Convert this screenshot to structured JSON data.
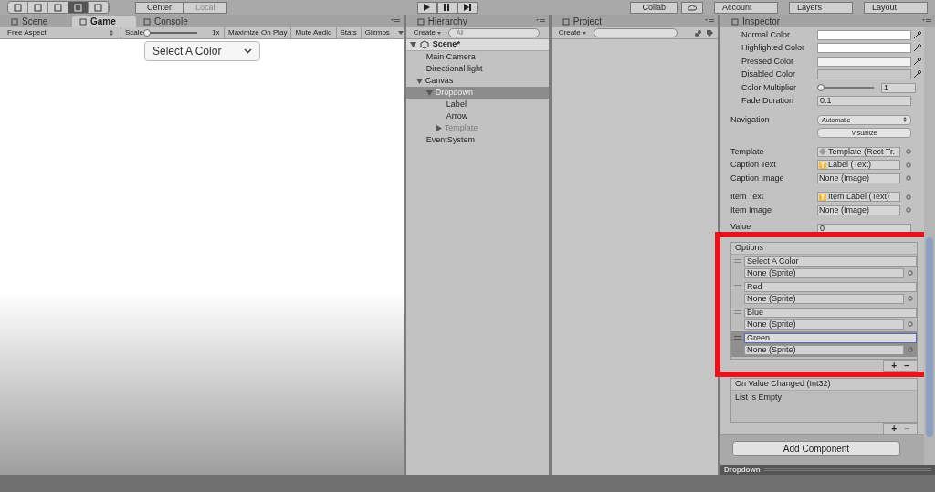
{
  "toolbar": {
    "pivot": [
      "Center",
      "Local"
    ],
    "collab": "Collab",
    "account": "Account",
    "layers": "Layers",
    "layout": "Layout"
  },
  "game_panel": {
    "tabs": [
      {
        "label": "Scene",
        "selected": false
      },
      {
        "label": "Game",
        "selected": true
      },
      {
        "label": "Console",
        "selected": false
      }
    ],
    "aspect": "Free Aspect",
    "scale_label": "Scale",
    "scale": {
      "level": 0.0
    },
    "scale_value": "1x",
    "toggles": [
      {
        "label": "Maximize On Play",
        "on": false
      },
      {
        "label": "Mute Audio",
        "on": false
      },
      {
        "label": "Stats",
        "on": false
      },
      {
        "label": "Gizmos",
        "on": false
      }
    ],
    "dropdown": "Select A Color"
  },
  "hierarchy": {
    "tab": "Hierarchy",
    "create": "Create",
    "search_placeholder": "All",
    "scene": "Scene*",
    "items": [
      {
        "label": "Main Camera",
        "selected": false,
        "active": true
      },
      {
        "label": "Directional light",
        "selected": false,
        "active": true
      },
      {
        "label": "Canvas",
        "selected": false,
        "active": true,
        "expanded": true,
        "children": [
          {
            "label": "Dropdown",
            "selected": true,
            "active": true,
            "expanded": true,
            "children": [
              {
                "label": "Label",
                "selected": false,
                "active": true
              },
              {
                "label": "Arrow",
                "selected": false,
                "active": true
              },
              {
                "label": "Template",
                "selected": false,
                "active": false,
                "expanded": false
              }
            ]
          }
        ]
      },
      {
        "label": "EventSystem",
        "selected": false,
        "active": true
      }
    ]
  },
  "project": {
    "tab": "Project",
    "create": "Create"
  },
  "inspector": {
    "tab": "Inspector",
    "colors": [
      {
        "label": "Normal Color",
        "color": "#ffffff"
      },
      {
        "label": "Highlighted Color",
        "color": "#ffffff"
      },
      {
        "label": "Pressed Color",
        "color": "#f2f2f2"
      },
      {
        "label": "Disabled Color",
        "color": "#c8c8c8"
      }
    ],
    "color_multiplier": {
      "label": "Color Multiplier",
      "level": 0.0,
      "value": "1"
    },
    "fade_duration": {
      "label": "Fade Duration",
      "value": "0.1"
    },
    "navigation": {
      "label": "Navigation",
      "value": "Automatic",
      "button": "Visualize"
    },
    "ref_groups": [
      [
        {
          "label": "Template",
          "value": "Template (Rect Tr.",
          "kind": "rect"
        },
        {
          "label": "Caption Text",
          "value": "Label (Text)",
          "kind": "text"
        },
        {
          "label": "Caption Image",
          "value": "None (Image)",
          "kind": "none"
        }
      ],
      [
        {
          "label": "Item Text",
          "value": "Item Label (Text)",
          "kind": "text"
        },
        {
          "label": "Item Image",
          "value": "None (Image)",
          "kind": "none"
        }
      ]
    ],
    "value": {
      "label": "Value",
      "value": "0"
    },
    "options": {
      "header": "Options",
      "items": [
        {
          "text": "Select A Color",
          "image": "None (Sprite)",
          "selected": false
        },
        {
          "text": "Red",
          "image": "None (Sprite)",
          "selected": false
        },
        {
          "text": "Blue",
          "image": "None (Sprite)",
          "selected": false
        },
        {
          "text": "Green",
          "image": "None (Sprite)",
          "selected": true
        }
      ],
      "add": "+",
      "remove": "−"
    },
    "event": {
      "header": "On Value Changed (Int32)",
      "empty": "List is Empty",
      "add": "+",
      "remove": "−"
    },
    "add_component": "Add Component",
    "footer": "Dropdown"
  }
}
